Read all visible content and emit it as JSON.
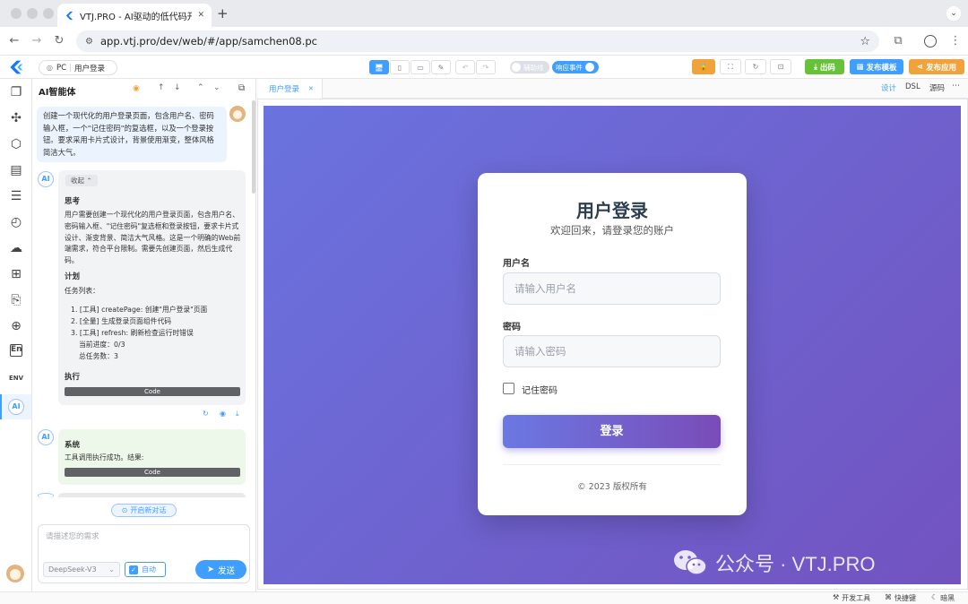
{
  "browser": {
    "tab_title": "VTJ.PRO - AI驱动的低代码开发",
    "tab_close": "✕",
    "new_tab": "+",
    "url": "app.vtj.pro/dev/web/#/app/samchen08.pc"
  },
  "toolbar": {
    "platform": "PC",
    "page_name": "用户登录",
    "toggle_helper": "辅助线",
    "toggle_event": "响应事件",
    "publish_code": "出码",
    "publish_template": "发布模板",
    "publish_app": "发布应用"
  },
  "ai": {
    "title": "AI智能体",
    "user_prompt": "创建一个现代化的用户登录页面，包含用户名、密码输入框，一个\"记住密码\"的复选框，以及一个登录按钮。要求采用卡片式设计，背景使用渐变，整体风格简洁大气。",
    "collapse": "收起",
    "think_title": "思考",
    "think_text": "用户需要创建一个现代化的用户登录页面，包含用户名、密码输入框、\"记住密码\"复选框和登录按钮，要求卡片式设计、渐变背景、简洁大气风格。这是一个明确的Web前端需求，符合平台限制。需要先创建页面，然后生成代码。",
    "plan_title": "计划",
    "plan_intro": "任务列表：",
    "plan_items": [
      "1. [工具] createPage: 创建\"用户登录\"页面",
      "2. [全量] 生成登录页面组件代码",
      "3. [工具] refresh: 刷新检查运行时错误"
    ],
    "progress": "当前进度：0/3",
    "total": "总任务数：3",
    "exec_title": "执行",
    "code_label": "Code",
    "system_title": "系统",
    "system_text": "工具调用执行成功。结果:",
    "new_chat": "开启新对话",
    "input_placeholder": "请描述您的需求",
    "model": "DeepSeek-V3",
    "auto": "自动",
    "send": "发送"
  },
  "editor": {
    "tab": "用户登录",
    "view_design": "设计",
    "view_dsl": "DSL",
    "view_source": "源码"
  },
  "login": {
    "title": "用户登录",
    "subtitle": "欢迎回来，请登录您的账户",
    "username_label": "用户名",
    "username_placeholder": "请输入用户名",
    "password_label": "密码",
    "password_placeholder": "请输入密码",
    "remember": "记住密码",
    "submit": "登录",
    "copyright": "© 2023 版权所有"
  },
  "watermark": "公众号 · VTJ.PRO",
  "status": {
    "devtools": "开发工具",
    "shortcuts": "快捷键",
    "theme": "暗黑"
  }
}
